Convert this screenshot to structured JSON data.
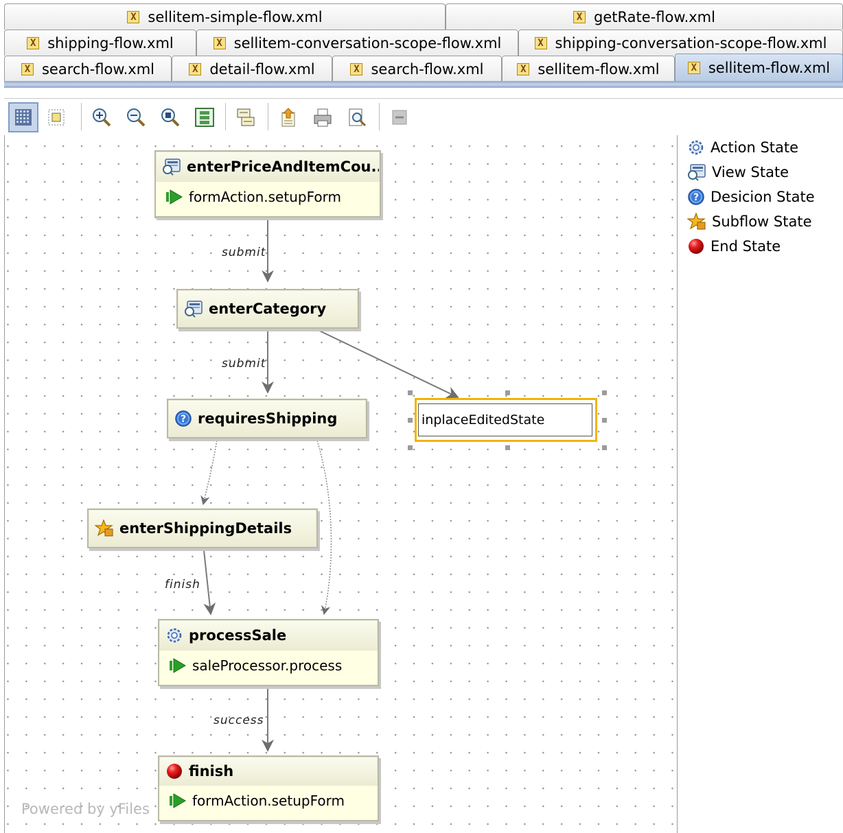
{
  "tabs": {
    "row1": [
      {
        "label": "sellitem-simple-flow.xml"
      },
      {
        "label": "getRate-flow.xml"
      }
    ],
    "row2": [
      {
        "label": "shipping-flow.xml"
      },
      {
        "label": "sellitem-conversation-scope-flow.xml"
      },
      {
        "label": "shipping-conversation-scope-flow.xml"
      }
    ],
    "row3": [
      {
        "label": "search-flow.xml"
      },
      {
        "label": "detail-flow.xml"
      },
      {
        "label": "search-flow.xml"
      },
      {
        "label": "sellitem-flow.xml"
      },
      {
        "label": "sellitem-flow.xml",
        "active": true
      }
    ],
    "file_icon": "xml-file-icon",
    "file_icon_glyph": "X"
  },
  "toolbar": {
    "buttons": [
      "grid-icon",
      "fit-page-icon",
      "zoom-in-icon",
      "zoom-out-icon",
      "zoom-actual-icon",
      "layout-icon",
      "properties-icon",
      "export-icon",
      "print-icon",
      "print-preview-icon",
      "disabled-icon"
    ]
  },
  "diagram": {
    "nodes": {
      "enterPriceAndItemCount": {
        "title": "enterPriceAndItemCou...",
        "action": "formAction.setupForm",
        "icon": "view-state-icon"
      },
      "enterCategory": {
        "title": "enterCategory",
        "icon": "view-state-icon"
      },
      "requiresShipping": {
        "title": "requiresShipping",
        "icon": "decision-state-icon"
      },
      "enterShippingDetails": {
        "title": "enterShippingDetails",
        "icon": "subflow-state-icon"
      },
      "processSale": {
        "title": "processSale",
        "action": "saleProcessor.process",
        "icon": "action-state-icon"
      },
      "finish": {
        "title": "finish",
        "action": "formAction.setupForm",
        "icon": "end-state-icon"
      }
    },
    "edge_labels": {
      "submit1": "submit",
      "submit2": "submit",
      "finish": "finish",
      "success": "success"
    },
    "inplace_editor_value": "inplaceEditedState",
    "watermark": "Powered by yFiles"
  },
  "palette": {
    "items": [
      {
        "label": "Action State",
        "icon": "action-state-icon"
      },
      {
        "label": "View State",
        "icon": "view-state-icon"
      },
      {
        "label": "Desicion State",
        "icon": "decision-state-icon"
      },
      {
        "label": "Subflow State",
        "icon": "subflow-state-icon"
      },
      {
        "label": "End State",
        "icon": "end-state-icon"
      }
    ]
  },
  "colors": {
    "node_fill": "#ffffe4",
    "selection": "#f3b400",
    "active_tab": "#b8cbe4",
    "action_arrow": "#2aa02a"
  }
}
